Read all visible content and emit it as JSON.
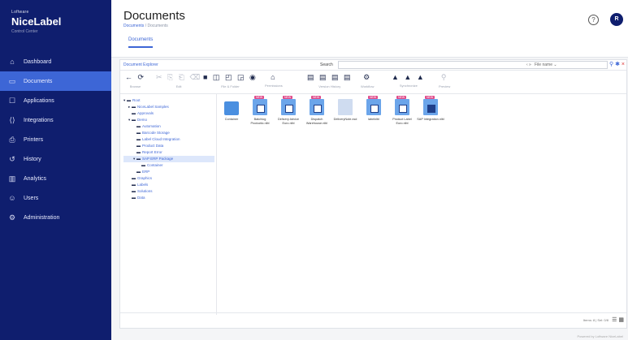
{
  "brand": {
    "small": "Loftware",
    "name": "NiceLabel",
    "sub": "Control Center"
  },
  "nav": [
    {
      "label": "Dashboard",
      "icon": "home-icon",
      "glyph": "⌂"
    },
    {
      "label": "Documents",
      "icon": "folder-icon",
      "glyph": "▭",
      "active": true
    },
    {
      "label": "Applications",
      "icon": "window-icon",
      "glyph": "☐"
    },
    {
      "label": "Integrations",
      "icon": "brackets-icon",
      "glyph": "⟨⟩"
    },
    {
      "label": "Printers",
      "icon": "printer-icon",
      "glyph": "⎙"
    },
    {
      "label": "History",
      "icon": "history-icon",
      "glyph": "↺"
    },
    {
      "label": "Analytics",
      "icon": "chart-icon",
      "glyph": "▥"
    },
    {
      "label": "Users",
      "icon": "users-icon",
      "glyph": "☺"
    },
    {
      "label": "Administration",
      "icon": "gear-icon",
      "glyph": "⚙"
    }
  ],
  "header": {
    "title": "Documents",
    "breadcrumb_root": "Documents",
    "breadcrumb_current": "Documents",
    "tab": "Documents",
    "avatar": "R"
  },
  "panel": {
    "title": "Document Explorer",
    "search_label": "Search",
    "search_placeholder": "",
    "filter_select": "File name"
  },
  "toolbar": [
    {
      "icons": "← ⟳",
      "label": "Browse",
      "dim": false
    },
    {
      "icons": "✂ ⎘ ⎗ ⌫",
      "label": "Edit",
      "dim": true
    },
    {
      "icons": "■ ◫ ◰ ◲ ◉",
      "label": "File & Folder",
      "dim": false
    },
    {
      "icons": "⌂",
      "label": "Permissions",
      "dim": false
    },
    {
      "icons": "▤ ▤ ▤ ▤",
      "label": "Version History",
      "dim": false
    },
    {
      "icons": "⚙",
      "label": "Workflow",
      "dim": false
    },
    {
      "icons": "▲ ▲ ▲",
      "label": "Synchronize",
      "dim": false
    },
    {
      "icons": "⚲",
      "label": "Preview",
      "dim": true
    }
  ],
  "tree": [
    {
      "label": "Root",
      "depth": 0,
      "toggle": "▾"
    },
    {
      "label": "NiceLabel Samples",
      "depth": 1,
      "toggle": "▸"
    },
    {
      "label": "Approvals",
      "depth": 1,
      "toggle": ""
    },
    {
      "label": "Demo",
      "depth": 1,
      "toggle": "▾"
    },
    {
      "label": "Automation",
      "depth": 2,
      "toggle": ""
    },
    {
      "label": "Barcode Storage",
      "depth": 2,
      "toggle": ""
    },
    {
      "label": "Label Cloud Integration",
      "depth": 2,
      "toggle": ""
    },
    {
      "label": "Product Data",
      "depth": 2,
      "toggle": ""
    },
    {
      "label": "Report Error",
      "depth": 2,
      "toggle": ""
    },
    {
      "label": "SAP ERP Package",
      "depth": 2,
      "toggle": "▾",
      "selected": true
    },
    {
      "label": "Container",
      "depth": 3,
      "toggle": ""
    },
    {
      "label": "ERP",
      "depth": 2,
      "toggle": ""
    },
    {
      "label": "Graphics",
      "depth": 1,
      "toggle": ""
    },
    {
      "label": "Labels",
      "depth": 1,
      "toggle": ""
    },
    {
      "label": "Solutions",
      "depth": 1,
      "toggle": ""
    },
    {
      "label": "Data",
      "depth": 1,
      "toggle": ""
    }
  ],
  "files": [
    {
      "name": "Container",
      "kind": "folder"
    },
    {
      "name": "Batchlog Productio.nlbl",
      "kind": "doc",
      "badge": "NEW"
    },
    {
      "name": "Delivery Advice Euro.nlbl",
      "kind": "doc",
      "badge": "NEW"
    },
    {
      "name": "Dispatch Warehouse.nlbl",
      "kind": "doc",
      "badge": "NEW"
    },
    {
      "name": "DeliveryNote.xsd",
      "kind": "doc-grey"
    },
    {
      "name": "labelnlbl",
      "kind": "doc",
      "badge": "NEW"
    },
    {
      "name": "Product Label Euro.nlbl",
      "kind": "doc",
      "badge": "NEW"
    },
    {
      "name": "SAP Integration.nlbl",
      "kind": "doc-dark",
      "badge": "NEW"
    }
  ],
  "footer": {
    "count": "Items: 8 | Sel: 0/8",
    "note": "Powered by Loftware NiceLabel"
  }
}
